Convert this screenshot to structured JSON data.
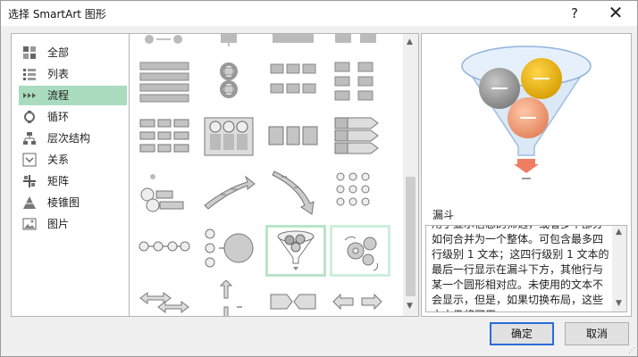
{
  "window": {
    "title": "选择 SmartArt 图形",
    "help_label": "?",
    "close_label": "✕"
  },
  "categories": [
    {
      "label": "全部",
      "icon": "all-grid-icon"
    },
    {
      "label": "列表",
      "icon": "list-icon"
    },
    {
      "label": "流程",
      "icon": "process-icon",
      "selected": true
    },
    {
      "label": "循环",
      "icon": "cycle-icon"
    },
    {
      "label": "层次结构",
      "icon": "hierarchy-icon"
    },
    {
      "label": "关系",
      "icon": "relationship-icon"
    },
    {
      "label": "矩阵",
      "icon": "matrix-icon"
    },
    {
      "label": "棱锥图",
      "icon": "pyramid-icon"
    },
    {
      "label": "图片",
      "icon": "picture-icon"
    }
  ],
  "layouts": {
    "selected_name": "漏斗",
    "scroll_up_arrow": "▲",
    "scroll_down_arrow": "▼"
  },
  "preview": {
    "title": "漏斗",
    "description": "用于显示信息的筛选，或者多个部分如何合并为一个整体。可包含最多四行级别 1 文本；这四行级别 1 文本的最后一行显示在漏斗下方，其他行与某一个圆形相对应。未使用的文本不会显示，但是，如果切换布局，这些文本仍将可用。",
    "colors": {
      "gray": "#8c8c8c",
      "yellow": "#e3ad00",
      "orange": "#ee9a74",
      "funnel": "#cde0f2",
      "arrow": "#ee7d62"
    }
  },
  "buttons": {
    "ok": "确定",
    "cancel": "取消"
  }
}
